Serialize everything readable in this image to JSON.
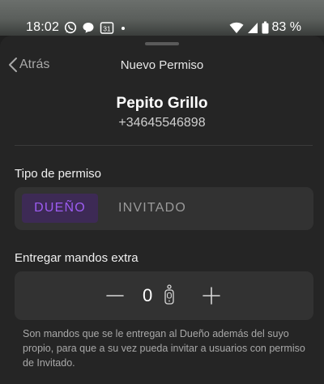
{
  "status_bar": {
    "time": "18:02",
    "battery": "83 %",
    "calendar_day": "31",
    "left_icons": [
      "whatsapp-icon",
      "message-icon",
      "calendar-icon",
      "dot-icon"
    ],
    "right_icons": [
      "wifi-icon",
      "signal-icon",
      "battery-icon"
    ]
  },
  "nav": {
    "back_label": "Atrás",
    "title": "Nuevo Permiso"
  },
  "user": {
    "name": "Pepito Grillo",
    "phone": "+34645546898"
  },
  "permission_type": {
    "label": "Tipo de permiso",
    "options": [
      "DUEÑO",
      "INVITADO"
    ],
    "selected": "DUEÑO"
  },
  "extra_remotes": {
    "label": "Entregar mandos extra",
    "value": "0",
    "icon": "remote-control-icon"
  },
  "help_text": "Son mandos que se le entregan al Dueño además del suyo propio, para que a su vez pueda invitar a usuarios con permiso de Invitado.",
  "colors": {
    "accent": "#9d5cf2",
    "accent_bg": "#3d2a55",
    "sheet_bg": "#252525",
    "control_bg": "#323232"
  }
}
